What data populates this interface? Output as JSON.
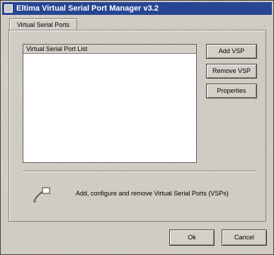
{
  "window": {
    "title": "Eltima Virtual Serial Port Manager v3.2"
  },
  "tabs": [
    {
      "label": "Virtual Serial Ports"
    }
  ],
  "list": {
    "header": "Virtual Serial Port List",
    "items": []
  },
  "buttons": {
    "add": "Add VSP",
    "remove": "Remove VSP",
    "properties": "Properties",
    "ok": "Ok",
    "cancel": "Cancel"
  },
  "info": {
    "icon": "info-icon",
    "text": "Add, configure and remove Virtual Serial Ports (VSPs)"
  }
}
